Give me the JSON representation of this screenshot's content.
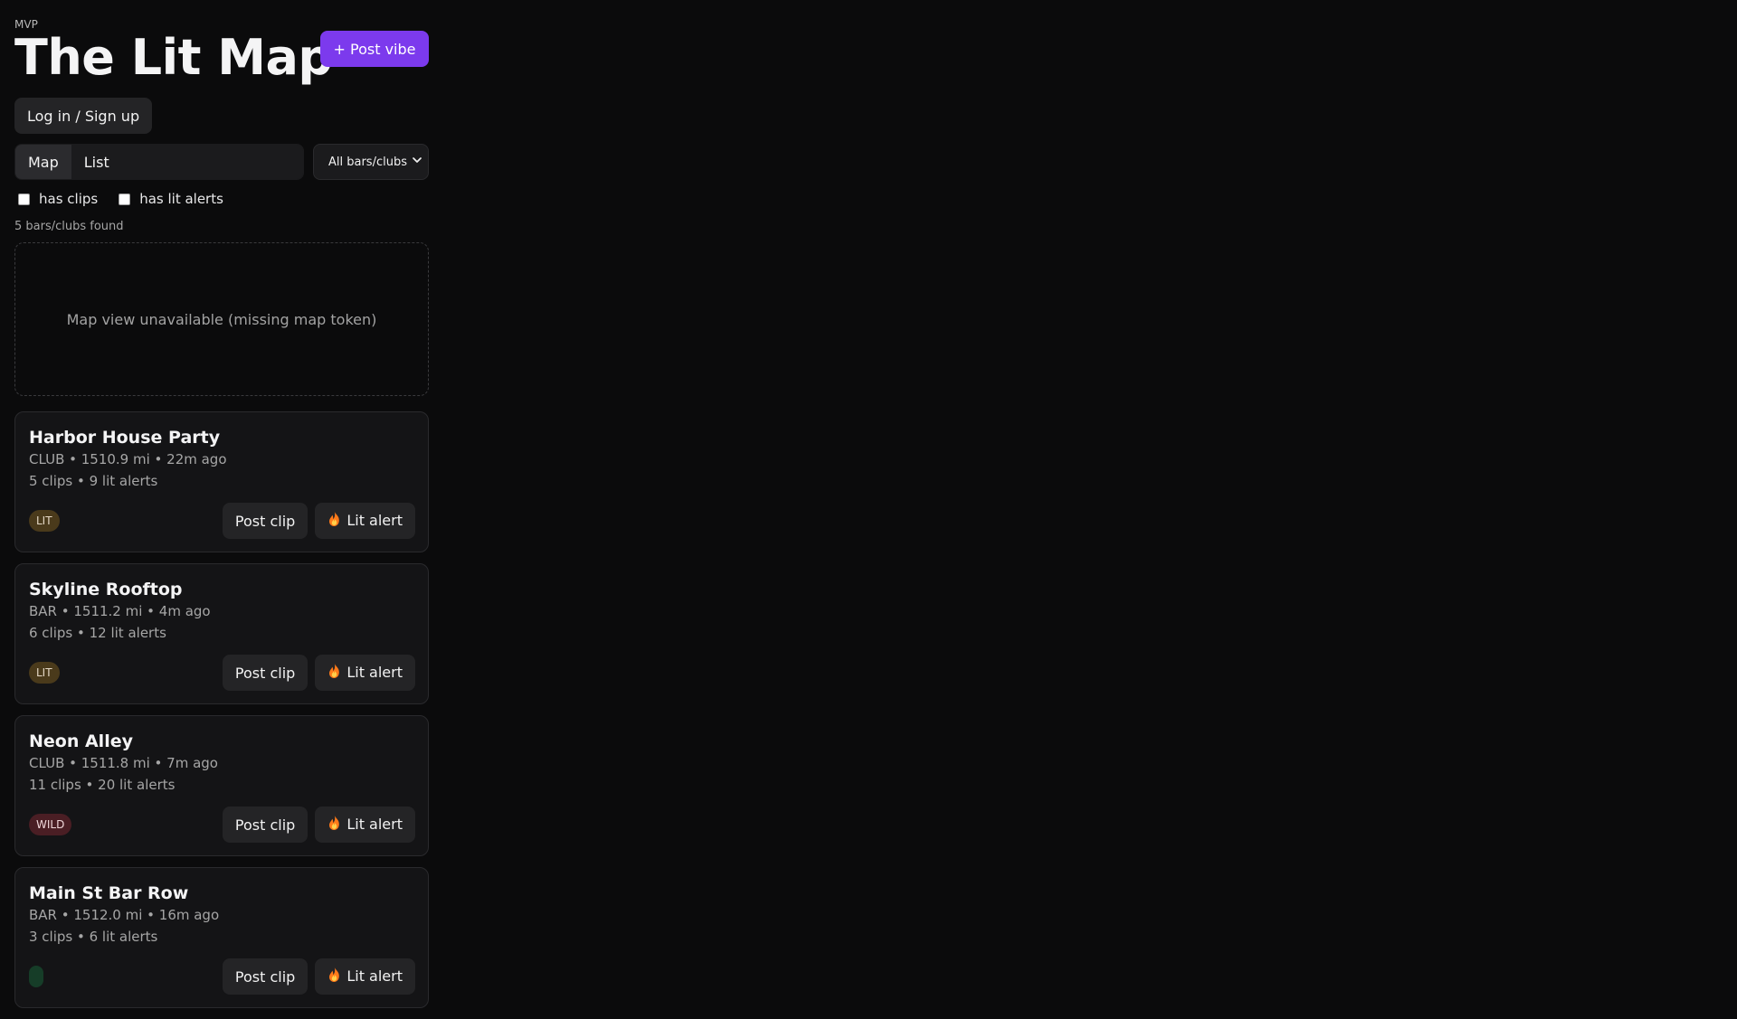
{
  "app": {
    "eyebrow": "MVP",
    "title": "The Lit Map",
    "post_vibe_label": "+ Post vibe",
    "login_label": "Log in / Sign up"
  },
  "view_toggle": {
    "map_label": "Map",
    "list_label": "List",
    "selected": "Map"
  },
  "filter_select": {
    "selected": "All bars/clubs"
  },
  "filters": {
    "has_clips": "has clips",
    "has_lit_alerts": "has lit alerts"
  },
  "summary": {
    "count_text": "5 bars/clubs found"
  },
  "map": {
    "placeholder": "Map view unavailable (missing map token)"
  },
  "card_actions": {
    "post_clip": "Post clip",
    "lit_alert": "Lit alert"
  },
  "venues": [
    {
      "name": "Harbor House Party",
      "meta": "CLUB • 1510.9 mi • 22m ago",
      "stats": "5 clips • 9 lit alerts",
      "badge": "LIT"
    },
    {
      "name": "Skyline Rooftop",
      "meta": "BAR • 1511.2 mi • 4m ago",
      "stats": "6 clips • 12 lit alerts",
      "badge": "LIT"
    },
    {
      "name": "Neon Alley",
      "meta": "CLUB • 1511.8 mi • 7m ago",
      "stats": "11 clips • 20 lit alerts",
      "badge": "WILD"
    },
    {
      "name": "Main St Bar Row",
      "meta": "BAR • 1512.0 mi • 16m ago",
      "stats": "3 clips • 6 lit alerts",
      "badge": ""
    }
  ],
  "colors": {
    "background": "#0b0b0c",
    "accent": "#7c3aed",
    "card": "#141416",
    "button": "#242426",
    "lit_badge": "#4a3a1b",
    "wild_badge": "#4a1e24",
    "bottom_badge": "#163d28"
  },
  "icons": {
    "lit_alert": "fire-icon",
    "select": "chevron-down-icon"
  }
}
